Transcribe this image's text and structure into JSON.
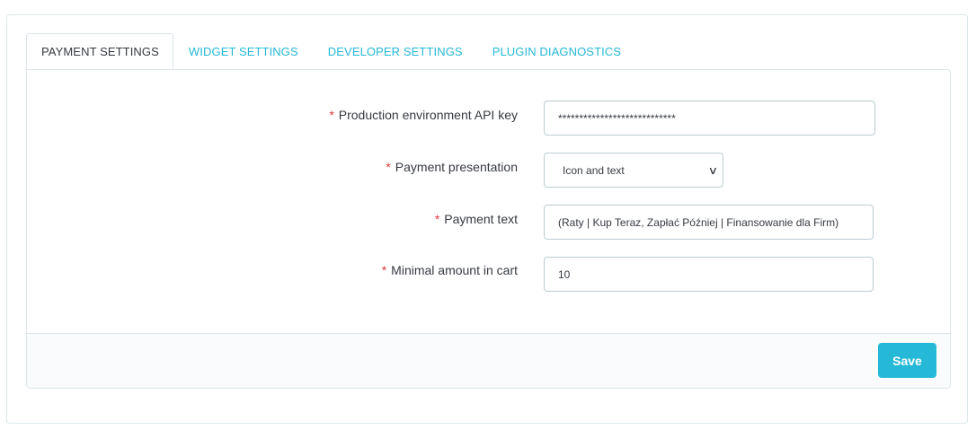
{
  "tabs": [
    {
      "label": "PAYMENT SETTINGS",
      "active": true
    },
    {
      "label": "WIDGET SETTINGS",
      "active": false
    },
    {
      "label": "DEVELOPER SETTINGS",
      "active": false
    },
    {
      "label": "PLUGIN DIAGNOSTICS",
      "active": false
    }
  ],
  "form": {
    "required_marker": "*",
    "api_key": {
      "label": "Production environment API key",
      "value": "****************************"
    },
    "presentation": {
      "label": "Payment presentation",
      "value": "Icon and text"
    },
    "payment_text": {
      "label": "Payment text",
      "value": "(Raty | Kup Teraz, Zapłać Później | Finansowanie dla Firm)"
    },
    "min_amount": {
      "label": "Minimal amount in cart",
      "value": "10"
    }
  },
  "footer": {
    "save_label": "Save"
  },
  "colors": {
    "accent": "#25b9d7",
    "required": "#e03a3a",
    "border": "#dbe6e9"
  }
}
